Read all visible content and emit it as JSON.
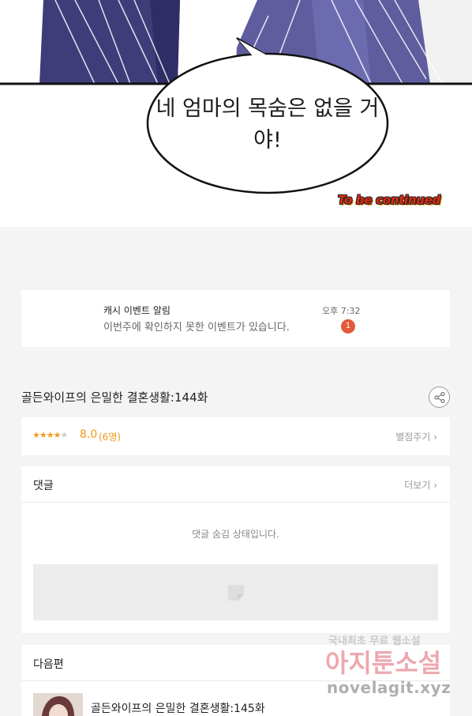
{
  "comic": {
    "speech_bubble": "네 엄마의 목숨은 없을 거야!",
    "to_be_continued": "To be continued"
  },
  "notification": {
    "title": "캐시 이벤트 알림",
    "body": "이번주에 확인하지 못한 이벤트가 있습니다.",
    "time": "오후 7:32",
    "badge_count": "1",
    "badge_color": "#e35a3a"
  },
  "episode": {
    "title": "골든와이프의 은밀한 결혼생활:144화",
    "share_icon": "share-icon"
  },
  "rating": {
    "stars_filled": 4,
    "stars_total": 5,
    "score": "8.0",
    "count": "(6명)",
    "rate_label": "별점주기",
    "accent_color": "#f29a1d"
  },
  "comments": {
    "title": "댓글",
    "more_label": "더보기",
    "hidden_message": "댓글 숨김 상태입니다."
  },
  "next": {
    "title": "다음편",
    "episode_title": "골든와이프의 은밀한 결혼생활:145화"
  },
  "watermark": {
    "line1": "국내최초 무료 웹소설",
    "line2": "아지툰소설",
    "line3": "novelagit.xyz"
  }
}
